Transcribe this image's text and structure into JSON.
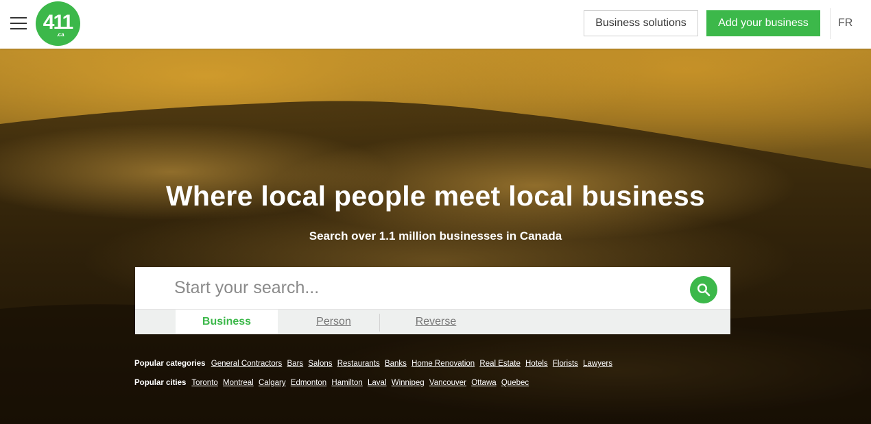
{
  "header": {
    "logo_text": "411",
    "logo_sub": ".ca",
    "business_solutions": "Business solutions",
    "add_business": "Add your business",
    "language": "FR"
  },
  "hero": {
    "headline": "Where local people meet local business",
    "subheadline": "Search over 1.1 million businesses in Canada"
  },
  "search": {
    "placeholder": "Start your search...",
    "tabs": [
      "Business",
      "Person",
      "Reverse"
    ],
    "active_tab": "Business"
  },
  "popular_categories": {
    "label": "Popular categories",
    "items": [
      "General Contractors",
      "Bars",
      "Salons",
      "Restaurants",
      "Banks",
      "Home Renovation",
      "Real Estate",
      "Hotels",
      "Florists",
      "Lawyers"
    ]
  },
  "popular_cities": {
    "label": "Popular cities",
    "items": [
      "Toronto",
      "Montreal",
      "Calgary",
      "Edmonton",
      "Hamilton",
      "Laval",
      "Winnipeg",
      "Vancouver",
      "Ottawa",
      "Quebec"
    ]
  },
  "colors": {
    "brand_green": "#3cb84a",
    "header_bg": "#ffffff",
    "tab_bar_bg": "#eef0ef"
  }
}
